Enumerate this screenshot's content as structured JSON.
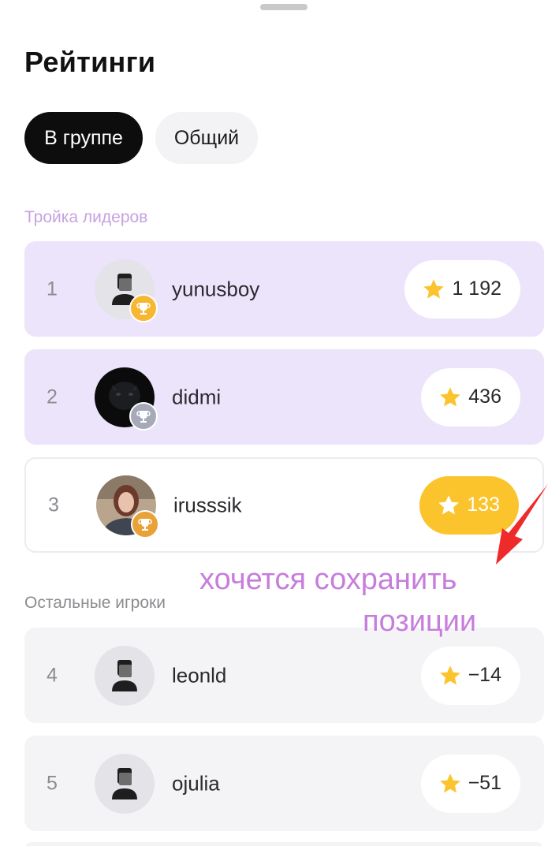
{
  "header": {
    "title": "Рейтинги"
  },
  "tabs": [
    {
      "label": "В группе",
      "active": true
    },
    {
      "label": "Общий",
      "active": false
    }
  ],
  "sections": {
    "leaders_label": "Тройка лидеров",
    "others_label": "Остальные игроки"
  },
  "leaders": [
    {
      "rank": "1",
      "username": "yunusboy",
      "score": "1 192",
      "trophy": "gold-trophy-icon",
      "avatar": "default-user-icon"
    },
    {
      "rank": "2",
      "username": "didmi",
      "score": "436",
      "trophy": "silver-trophy-icon",
      "avatar": "photo-black-panther"
    },
    {
      "rank": "3",
      "username": "irusssik",
      "score": "133",
      "trophy": "bronze-trophy-icon",
      "avatar": "photo-woman"
    }
  ],
  "others": [
    {
      "rank": "4",
      "username": "leonld",
      "score": "−14",
      "avatar": "default-user-icon"
    },
    {
      "rank": "5",
      "username": "ojulia",
      "score": "−51",
      "avatar": "default-user-icon"
    }
  ],
  "annotation": {
    "line1": "хочется сохранить",
    "line2": "позиции"
  },
  "colors": {
    "leader_row_bg": "#ece4fa",
    "leaders_label": "#c7a2e2",
    "star": "#fbc42d",
    "annotation_text": "#c77ddc",
    "annotation_arrow": "#ee2a2a"
  }
}
